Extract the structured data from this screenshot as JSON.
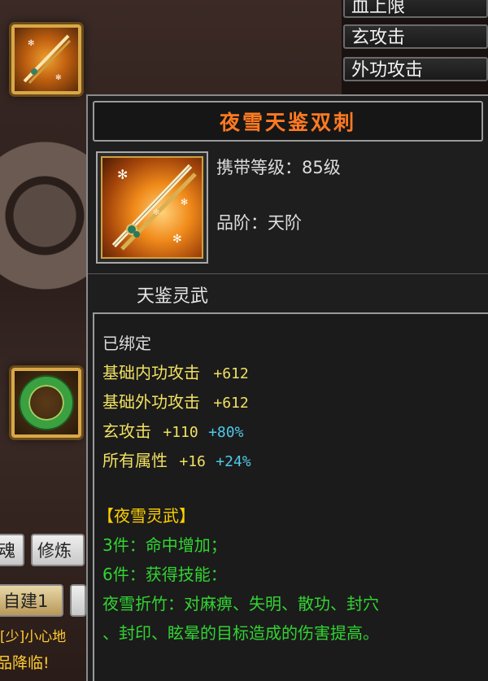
{
  "background": {
    "stat_tabs": [
      "血上限",
      "玄攻击",
      "外功攻击"
    ],
    "buttons": [
      "魂",
      "修炼",
      "自建1"
    ],
    "scroll_lines": [
      "[少]小心地",
      "品降临!"
    ]
  },
  "tooltip": {
    "item_name": "夜雪天鉴双刺",
    "carry_level_label": "携带等级：85级",
    "grade_label": "品阶：天阶",
    "category": "天鉴灵武",
    "bind_status": "已绑定",
    "stats": [
      {
        "name": "基础内功攻击",
        "value": "+612",
        "pct": ""
      },
      {
        "name": "基础外功攻击",
        "value": "+612",
        "pct": ""
      },
      {
        "name": "玄攻击",
        "value": "+110",
        "pct": "+80%"
      },
      {
        "name": "所有属性",
        "value": "+16",
        "pct": "+24%"
      }
    ],
    "set_name": "【夜雪灵武】",
    "set_bonuses": [
      "3件：命中增加；",
      "6件：获得技能："
    ],
    "skill_line1": "夜雪折竹：对麻痹、失明、散功、封穴",
    "skill_line2": "、封印、眩晕的目标造成的伤害提高。"
  },
  "colors": {
    "title": "#ff7a22",
    "stat_name_yellow": "#f0e060",
    "percent_cyan": "#50c8e8",
    "set_green": "#32d432",
    "set_name_gold": "#ffd000"
  },
  "icons": [
    "weapon-twin-blades-icon",
    "jade-ring-icon"
  ]
}
